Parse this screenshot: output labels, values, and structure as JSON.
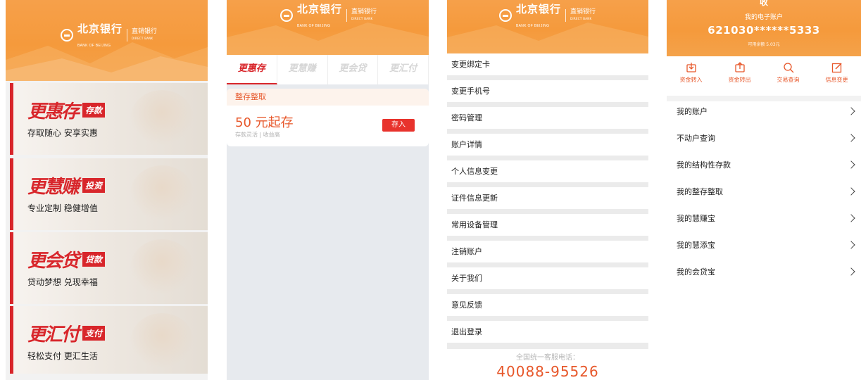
{
  "bank": {
    "name_cn": "北京银行",
    "name_en": "BANK OF BEIJING",
    "division_cn": "直销银行",
    "division_en": "DIRECT BANK"
  },
  "home": {
    "promos": [
      {
        "title": "更惠存",
        "tag": "存款",
        "subtitle": "存取随心 安享实惠"
      },
      {
        "title": "更慧赚",
        "tag": "投资",
        "subtitle": "专业定制 稳健增值"
      },
      {
        "title": "更会贷",
        "tag": "贷款",
        "subtitle": "贷动梦想 兑现幸福"
      },
      {
        "title": "更汇付",
        "tag": "支付",
        "subtitle": "轻松支付 更汇生活"
      }
    ]
  },
  "product": {
    "tabs": [
      "更惠存",
      "更慧赚",
      "更会贷",
      "更汇付"
    ],
    "active_tab": 0,
    "card": {
      "header": "整存整取",
      "amount": "50 元起存",
      "desc": "存款灵活 | 收益高",
      "button": "存入"
    }
  },
  "settings": {
    "menu": [
      "变更绑定卡",
      "变更手机号",
      "密码管理",
      "账户详情",
      "个人信息变更",
      "证件信息更新",
      "常用设备管理",
      "注销账户",
      "关于我们",
      "意见反馈",
      "退出登录"
    ],
    "hotline_label": "全国统一客服电话：",
    "hotline_number": "40088-95526"
  },
  "account": {
    "top_label": "收",
    "label": "我的电子账户",
    "number": "621030******5333",
    "balance": "可用余额 5.03元",
    "actions": [
      {
        "label": "资金转入",
        "icon": "transfer-in-icon"
      },
      {
        "label": "资金转出",
        "icon": "transfer-out-icon"
      },
      {
        "label": "交易查询",
        "icon": "search-icon"
      },
      {
        "label": "信息变更",
        "icon": "edit-icon"
      }
    ],
    "list": [
      "我的账户",
      "不动户查询",
      "我的结构性存款",
      "我的整存整取",
      "我的慧赚宝",
      "我的慧添宝",
      "我的会贷宝"
    ]
  },
  "colors": {
    "brand_orange": "#f59a3c",
    "accent_red": "#d8262b",
    "accent_orange": "#e7572a"
  }
}
